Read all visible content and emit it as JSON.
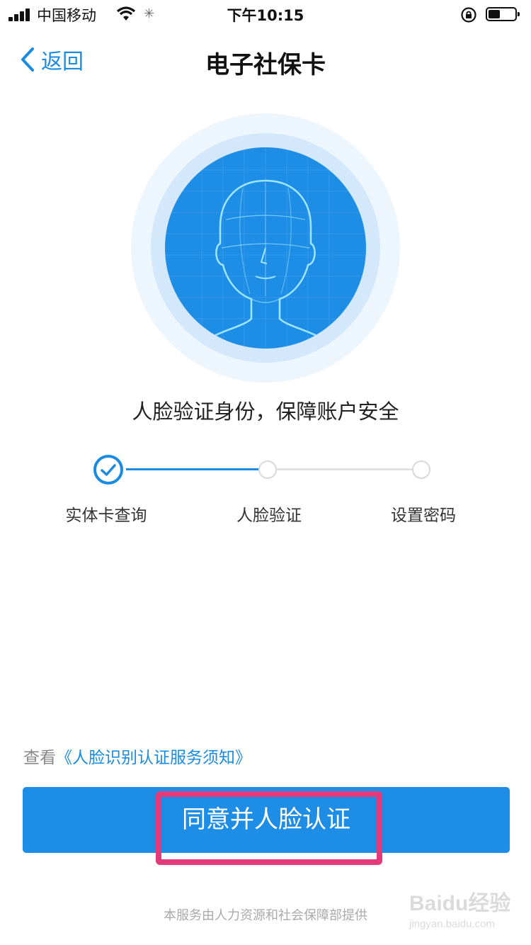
{
  "status_bar": {
    "carrier": "中国移动",
    "time": "下午10:15",
    "battery_level": 0.45
  },
  "nav": {
    "back_label": "返回",
    "title": "电子社保卡"
  },
  "headline": "人脸验证身份，保障账户安全",
  "steps": [
    {
      "label": "实体卡查询",
      "state": "done"
    },
    {
      "label": "人脸验证",
      "state": "pending"
    },
    {
      "label": "设置密码",
      "state": "pending"
    }
  ],
  "notice": {
    "prefix": "查看",
    "link": "《人脸识别认证服务须知》"
  },
  "agree_button": "同意并人脸认证",
  "footer": "本服务由人力资源和社会保障部提供",
  "watermark": {
    "logo_text": "Baidu经验",
    "sub_text": "jingyan.baidu.com"
  },
  "colors": {
    "accent": "#1b8be0",
    "button": "#1e8de6",
    "highlight": "#e23a7b"
  }
}
